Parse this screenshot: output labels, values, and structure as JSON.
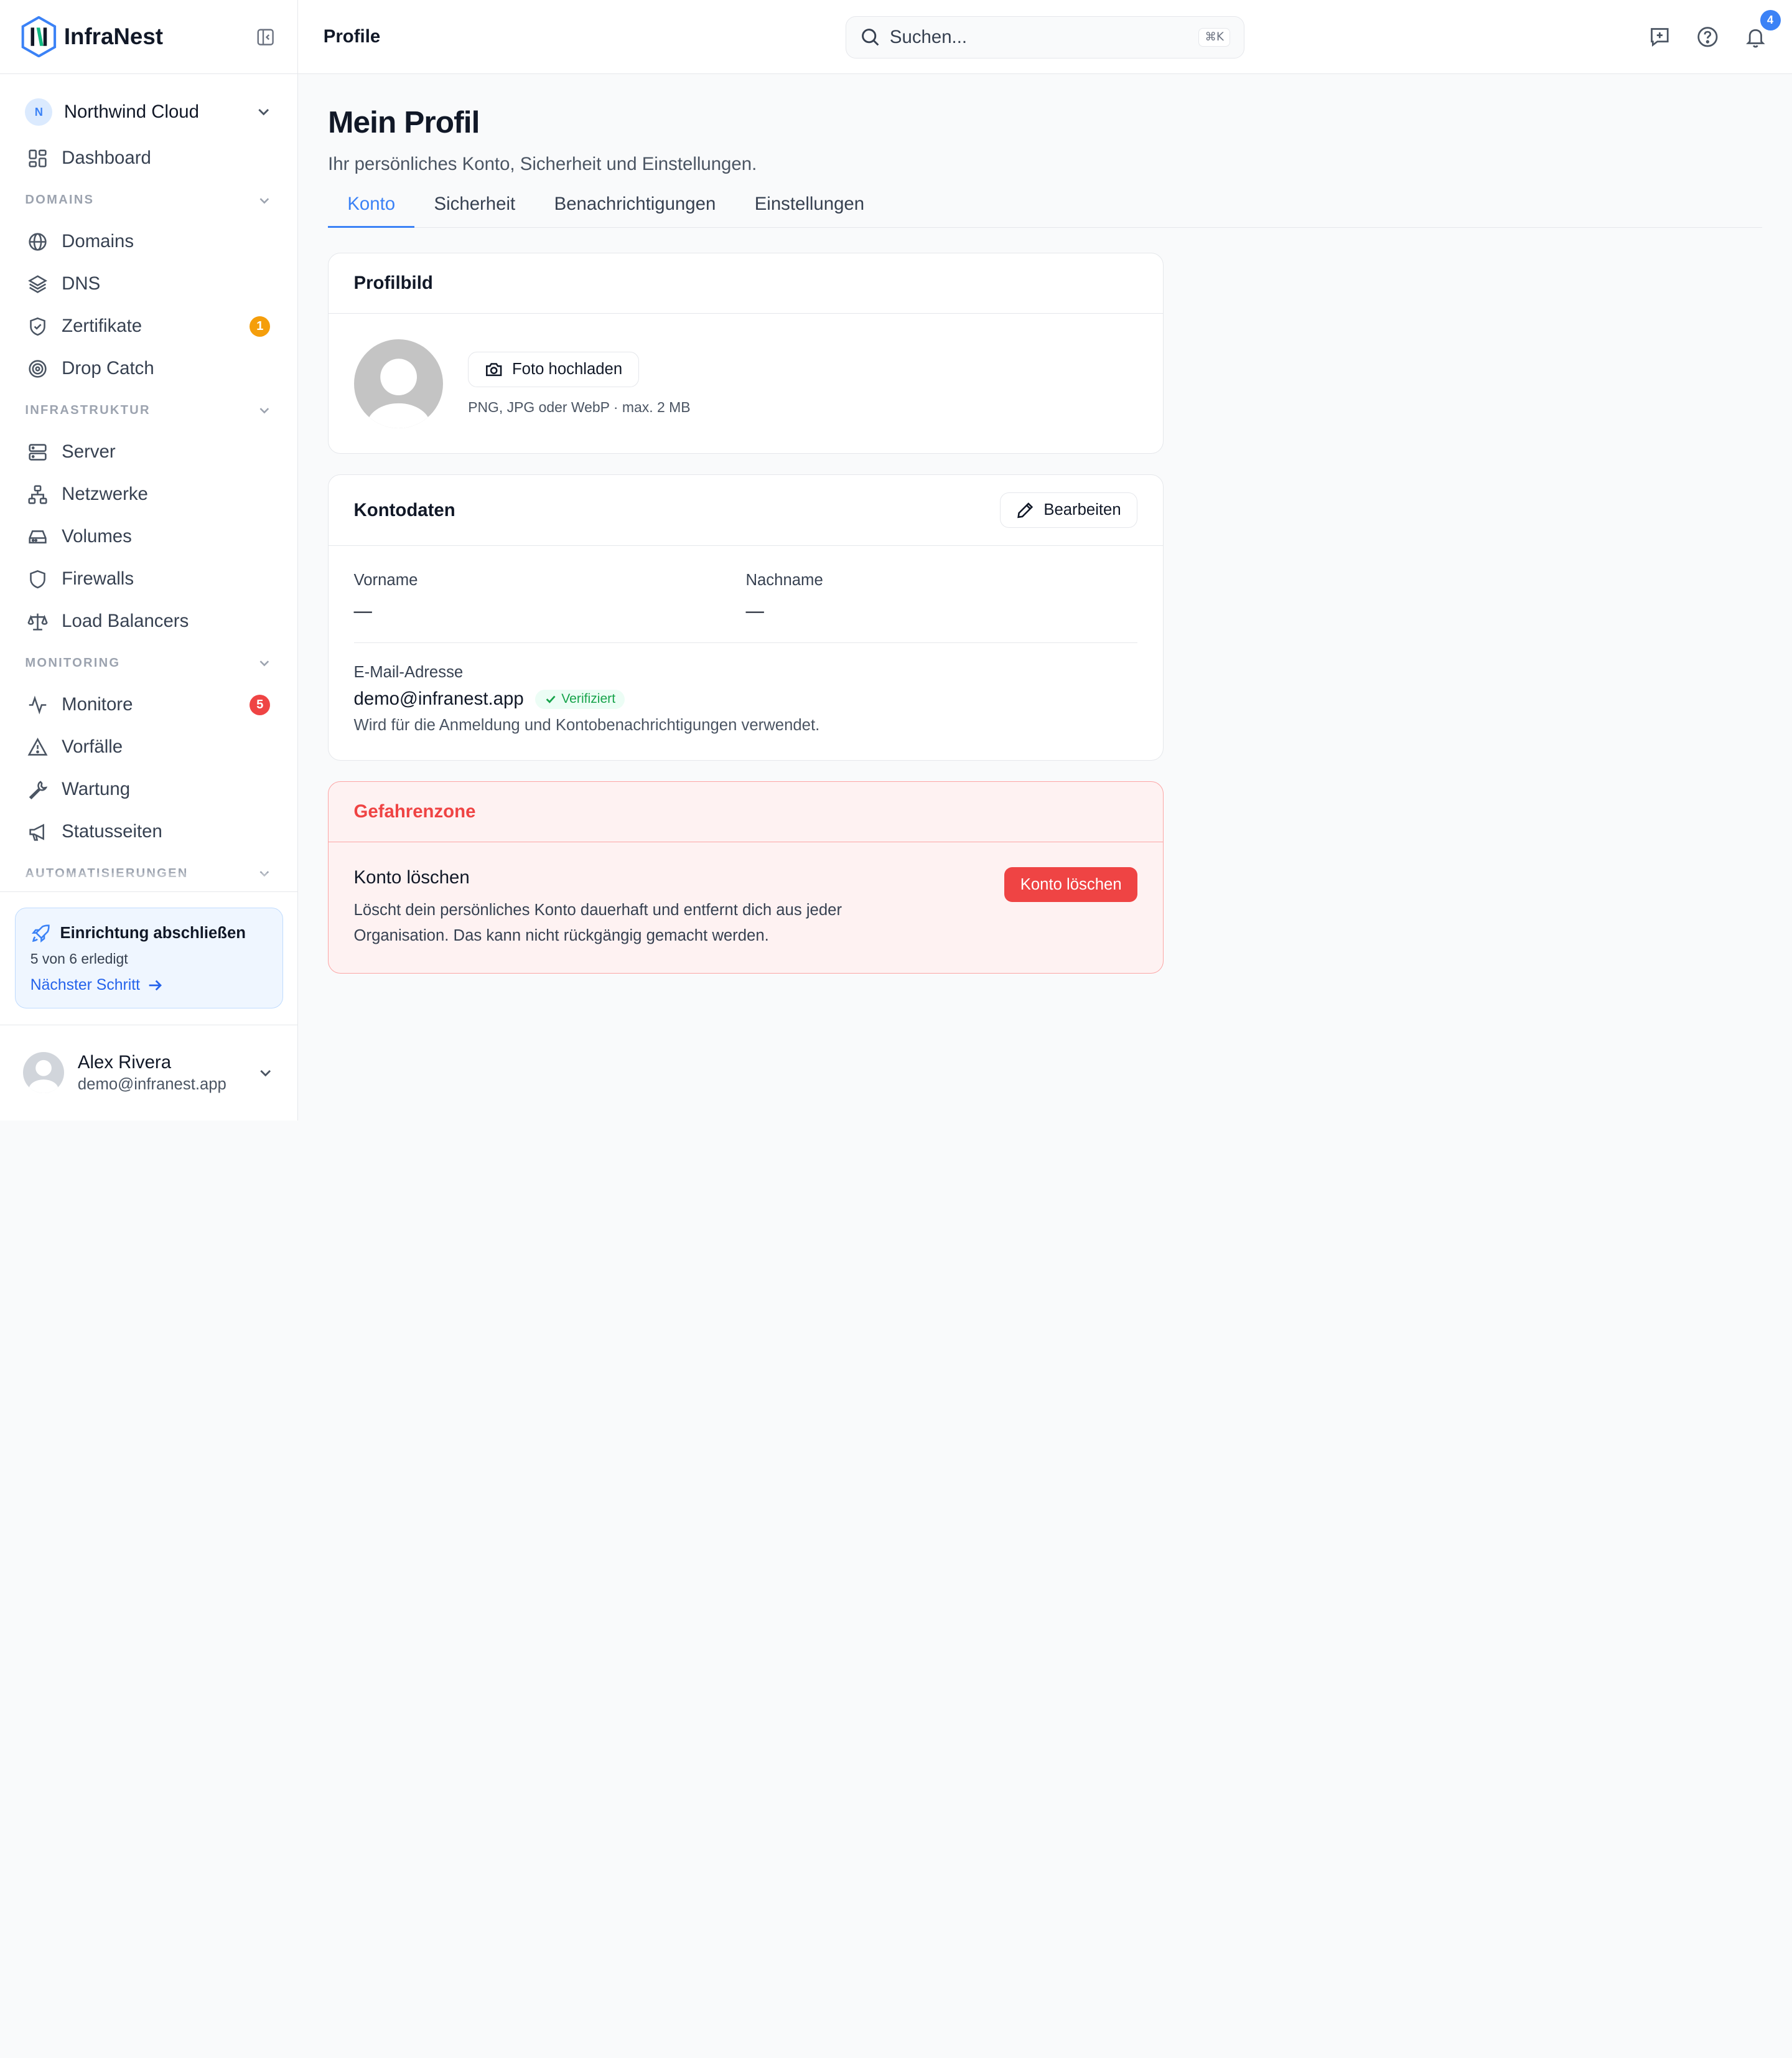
{
  "brand": {
    "name": "InfraNest"
  },
  "org": {
    "initial": "N",
    "name": "Northwind Cloud"
  },
  "nav": {
    "dashboard": "Dashboard",
    "sections": {
      "domains": "DOMAINS",
      "infra": "INFRASTRUKTUR",
      "monitoring": "MONITORING",
      "automation": "AUTOMATISIERUNGEN"
    },
    "items": {
      "domains": "Domains",
      "dns": "DNS",
      "certs": "Zertifikate",
      "certs_badge": "1",
      "dropcatch": "Drop Catch",
      "server": "Server",
      "networks": "Netzwerke",
      "volumes": "Volumes",
      "firewalls": "Firewalls",
      "loadbalancers": "Load Balancers",
      "monitors": "Monitore",
      "monitors_badge": "5",
      "incidents": "Vorfälle",
      "maintenance": "Wartung",
      "statuspages": "Statusseiten"
    }
  },
  "setup": {
    "title": "Einrichtung abschließen",
    "progress": "5 von 6 erledigt",
    "next": "Nächster Schritt"
  },
  "user": {
    "name": "Alex Rivera",
    "email": "demo@infranest.app"
  },
  "topbar": {
    "title": "Profile",
    "search_placeholder": "Suchen...",
    "shortcut": "⌘K",
    "notifications_count": "4"
  },
  "page": {
    "title": "Mein Profil",
    "subtitle": "Ihr persönliches Konto, Sicherheit und Einstellungen.",
    "tabs": [
      "Konto",
      "Sicherheit",
      "Benachrichtigungen",
      "Einstellungen"
    ],
    "active_tab": "Konto"
  },
  "profile_picture": {
    "title": "Profilbild",
    "upload_label": "Foto hochladen",
    "hint": "PNG, JPG oder WebP · max. 2 MB"
  },
  "account": {
    "title": "Kontodaten",
    "edit_label": "Bearbeiten",
    "first_name_label": "Vorname",
    "first_name_value": "—",
    "last_name_label": "Nachname",
    "last_name_value": "—",
    "email_label": "E-Mail-Adresse",
    "email_value": "demo@infranest.app",
    "verified_label": "Verifiziert",
    "email_note": "Wird für die Anmeldung und Kontobenachrichtigungen verwendet."
  },
  "danger": {
    "title": "Gefahrenzone",
    "action_title": "Konto löschen",
    "description": "Löscht dein persönliches Konto dauerhaft und entfernt dich aus jeder Organisation. Das kann nicht rückgängig gemacht werden.",
    "button_label": "Konto löschen"
  },
  "colors": {
    "accent": "#3b82f6",
    "danger": "#ef4444",
    "warning": "#f59e0b",
    "success": "#16a34a"
  }
}
